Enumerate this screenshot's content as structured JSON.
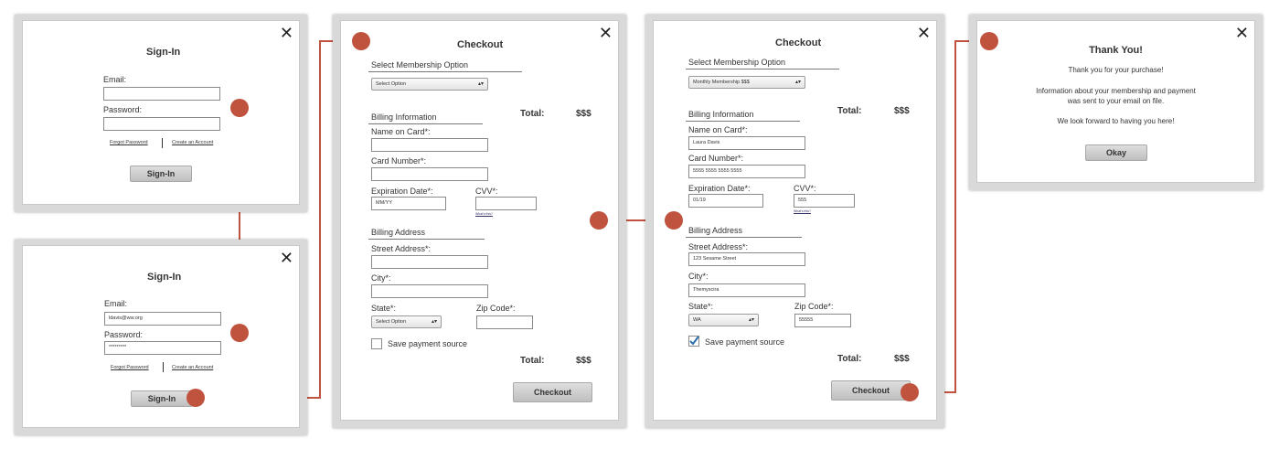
{
  "connector_color": "#c0533e",
  "signin_empty": {
    "close": "✕",
    "title": "Sign-In",
    "email_label": "Email:",
    "email_value": "",
    "password_label": "Password:",
    "password_value": "",
    "forgot_link": "Forgot Password",
    "create_link": "Create an Account",
    "signin_button": "Sign-In"
  },
  "signin_filled": {
    "close": "✕",
    "title": "Sign-In",
    "email_label": "Email:",
    "email_value": "ldavis@ww.org",
    "password_label": "Password:",
    "password_value": "*********",
    "forgot_link": "Forgot Password",
    "create_link": "Create an Account",
    "signin_button": "Sign-In"
  },
  "checkout_empty": {
    "close": "✕",
    "title": "Checkout",
    "membership_heading": "Select Membership Option",
    "membership_select": "Select Option",
    "total_label": "Total:",
    "total_value": "$$$",
    "billing_info_heading": "Billing Information",
    "name_label": "Name on Card*:",
    "name_value": "",
    "card_label": "Card Number*:",
    "card_value": "",
    "exp_label": "Expiration Date*:",
    "exp_value": "MM/YY",
    "cvv_label": "CVV*:",
    "cvv_value": "",
    "whats_this": "What's this?",
    "billing_address_heading": "Billing Address",
    "street_label": "Street Address*:",
    "street_value": "",
    "city_label": "City*:",
    "city_value": "",
    "state_label": "State*:",
    "state_select": "Select Option",
    "zip_label": "Zip Code*:",
    "zip_value": "",
    "save_label": "Save payment source",
    "save_checked": false,
    "bottom_total_label": "Total:",
    "bottom_total_value": "$$$",
    "checkout_button": "Checkout"
  },
  "checkout_filled": {
    "close": "✕",
    "title": "Checkout",
    "membership_heading": "Select Membership Option",
    "membership_select": "Monthly Membership   $$$",
    "total_label": "Total:",
    "total_value": "$$$",
    "billing_info_heading": "Billing Information",
    "name_label": "Name on Card*:",
    "name_value": "Laura Davis",
    "card_label": "Card Number*:",
    "card_value": "5555 5555 5555 5555",
    "exp_label": "Expiration Date*:",
    "exp_value": "01/19",
    "cvv_label": "CVV*:",
    "cvv_value": "555",
    "whats_this": "What's this?",
    "billing_address_heading": "Billing Address",
    "street_label": "Street Address*:",
    "street_value": "123 Sesame Street",
    "city_label": "City*:",
    "city_value": "Themyscira",
    "state_label": "State*:",
    "state_select": "WA",
    "zip_label": "Zip Code*:",
    "zip_value": "55555",
    "save_label": "Save payment source",
    "save_checked": true,
    "bottom_total_label": "Total:",
    "bottom_total_value": "$$$",
    "checkout_button": "Checkout"
  },
  "thankyou": {
    "close": "✕",
    "title": "Thank You!",
    "line1": "Thank you for your purchase!",
    "line2": "Information about your membership and payment",
    "line3": "was sent to your email on file.",
    "line4": "We look forward to having you here!",
    "okay_button": "Okay"
  }
}
